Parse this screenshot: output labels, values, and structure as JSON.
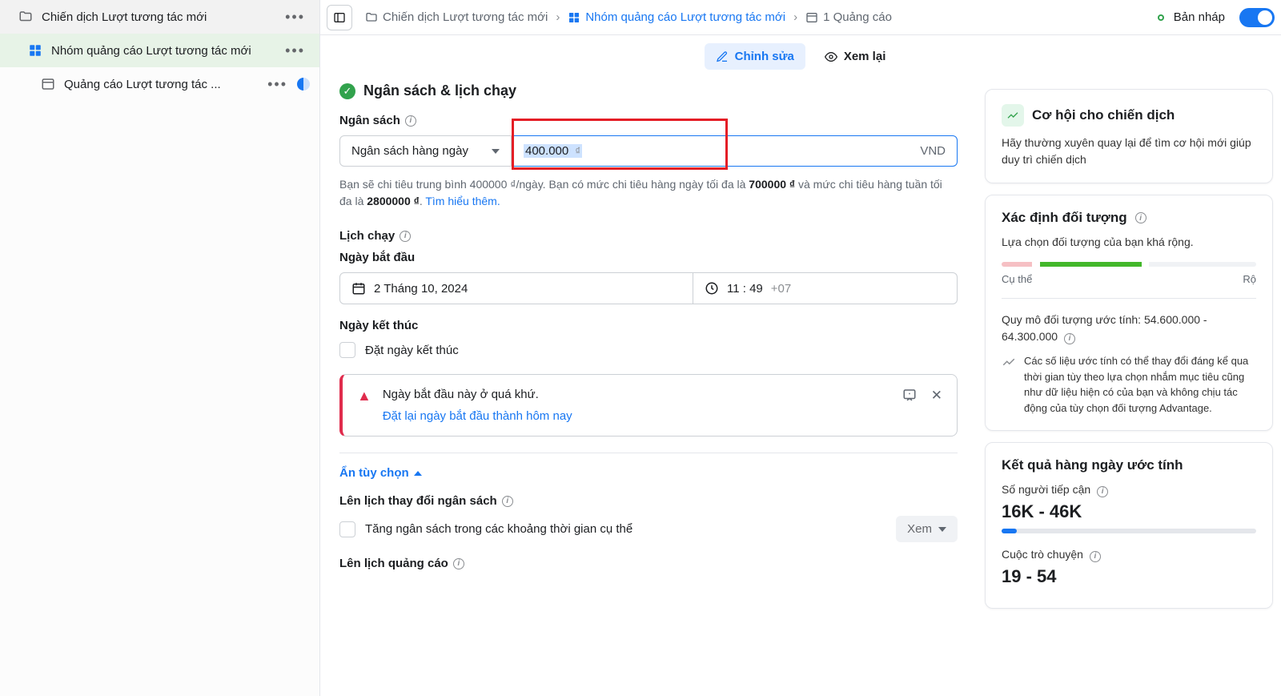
{
  "tree": {
    "campaign": "Chiến dịch Lượt tương tác mới",
    "adset": "Nhóm quảng cáo Lượt tương tác mới",
    "ad": "Quảng cáo Lượt tương tác ..."
  },
  "breadcrumb": {
    "campaign": "Chiến dịch Lượt tương tác mới",
    "adset": "Nhóm quảng cáo Lượt tương tác mới",
    "ad": "1 Quảng cáo",
    "status": "Bản nháp"
  },
  "tabs": {
    "edit": "Chỉnh sửa",
    "review": "Xem lại"
  },
  "budget": {
    "section_title": "Ngân sách & lịch chạy",
    "label": "Ngân sách",
    "select": "Ngân sách hàng ngày",
    "value": "400.000",
    "currency": "VND",
    "help_pre": "Bạn sẽ chi tiêu trung bình 400000 ₫/ngày. Bạn có mức chi tiêu hàng ngày tối đa là ",
    "help_max_daily": "700000 ₫",
    "help_mid": " và mức chi tiêu hàng tuần tối đa là ",
    "help_max_weekly": "2800000 ₫",
    "help_learn": "Tìm hiểu thêm."
  },
  "schedule": {
    "label": "Lịch chạy",
    "start_label": "Ngày bắt đầu",
    "start_date": "2 Tháng 10, 2024",
    "start_time": "11 : 49",
    "tz": "+07",
    "end_label": "Ngày kết thúc",
    "end_checkbox": "Đặt ngày kết thúc"
  },
  "alert": {
    "title": "Ngày bắt đầu này ở quá khứ.",
    "action": "Đặt lại ngày bắt đầu thành hôm nay"
  },
  "options": {
    "hide": "Ẩn tùy chọn",
    "schedule_budget_change": "Lên lịch thay đổi ngân sách",
    "increase_budget": "Tăng ngân sách trong các khoảng thời gian cụ thể",
    "view": "Xem",
    "schedule_ads": "Lên lịch quảng cáo"
  },
  "side": {
    "opportunity_title": "Cơ hội cho chiến dịch",
    "opportunity_text": "Hãy thường xuyên quay lại để tìm cơ hội mới giúp duy trì chiến dịch",
    "audience_title": "Xác định đối tượng",
    "audience_text": "Lựa chọn đối tượng của bạn khá rộng.",
    "specific": "Cụ thể",
    "broad": "Rộ",
    "size_label": "Quy mô đối tượng ước tính:",
    "size_value": "54.600.000 - 64.300.000",
    "size_note": "Các số liệu ước tính có thể thay đổi đáng kể qua thời gian tùy theo lựa chọn nhắm mục tiêu cũng như dữ liệu hiện có của bạn và không chịu tác động của tùy chọn đối tượng Advantage.",
    "results_title": "Kết quả hàng ngày ước tính",
    "reach_label": "Số người tiếp cận",
    "reach_value": "16K - 46K",
    "convo_label": "Cuộc trò chuyện",
    "convo_value": "19 - 54"
  }
}
